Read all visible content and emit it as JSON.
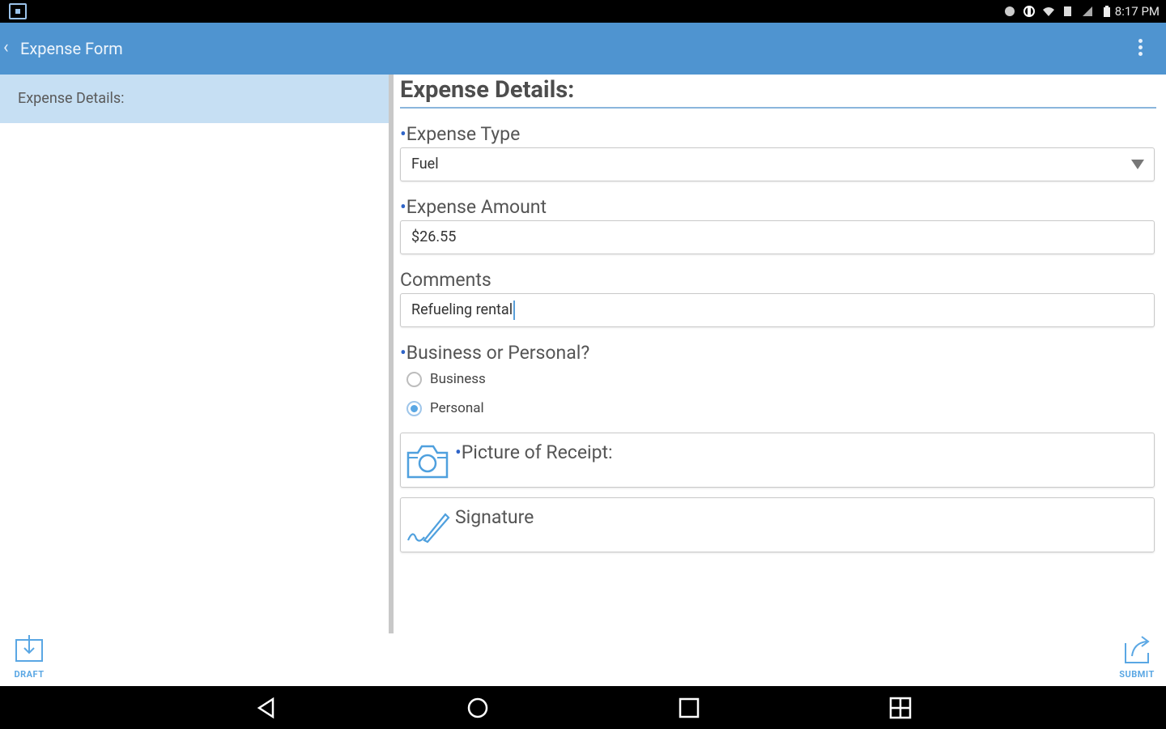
{
  "status_bar": {
    "time": "8:17 PM"
  },
  "app_bar": {
    "title": "Expense Form"
  },
  "sidebar": {
    "items": [
      {
        "label": "Expense Details:",
        "selected": true
      }
    ]
  },
  "form": {
    "section_title": "Expense Details:",
    "required_marker": "•",
    "expense_type": {
      "label": "Expense Type",
      "value": "Fuel",
      "required": true
    },
    "expense_amount": {
      "label": "Expense Amount",
      "value": "$26.55",
      "required": true
    },
    "comments": {
      "label": "Comments",
      "value": "Refueling rental",
      "required": false
    },
    "business_or_personal": {
      "label": "Business or Personal?",
      "required": true,
      "options": [
        {
          "label": "Business",
          "checked": false
        },
        {
          "label": "Personal",
          "checked": true
        }
      ]
    },
    "receipt": {
      "label": "Picture of Receipt:",
      "required": true,
      "icon": "camera-icon"
    },
    "signature": {
      "label": "Signature",
      "required": false,
      "icon": "signature-pen-icon"
    }
  },
  "actions": {
    "draft_label": "DRAFT",
    "submit_label": "SUBMIT"
  },
  "colors": {
    "app_bar": "#4f94d0",
    "sidebar_selected": "#c6dff3",
    "accent": "#5aa7e4",
    "required": "#2f64c8"
  },
  "nav_bar": {
    "buttons": [
      "back-icon",
      "home-icon",
      "recents-icon",
      "multiwindow-icon"
    ]
  }
}
